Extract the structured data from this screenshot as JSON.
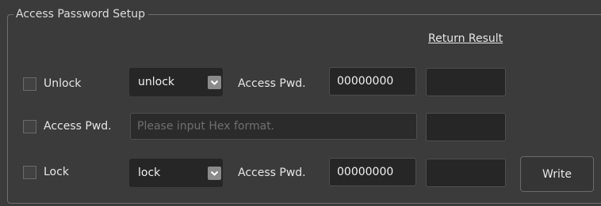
{
  "group": {
    "title": "Access Password Setup",
    "result_header": "Return Result"
  },
  "rows": [
    {
      "checkbox_label": "Unlock",
      "checked": false,
      "mode_value": "unlock",
      "pwd_label": "Access Pwd.",
      "pwd_value": "00000000",
      "result": ""
    },
    {
      "checkbox_label": "Access Pwd.",
      "checked": false,
      "hex_placeholder": "Please input Hex format.",
      "hex_value": "",
      "result": ""
    },
    {
      "checkbox_label": "Lock",
      "checked": false,
      "mode_value": "lock",
      "pwd_label": "Access Pwd.",
      "pwd_value": "00000000",
      "result": ""
    }
  ],
  "actions": {
    "write_label": "Write"
  },
  "icons": {
    "combo_arrow": "chevron-down-icon"
  },
  "colors": {
    "background": "#3b3b3b",
    "field": "#262626",
    "text": "#e6e6e6",
    "placeholder": "#6f6f6f"
  }
}
